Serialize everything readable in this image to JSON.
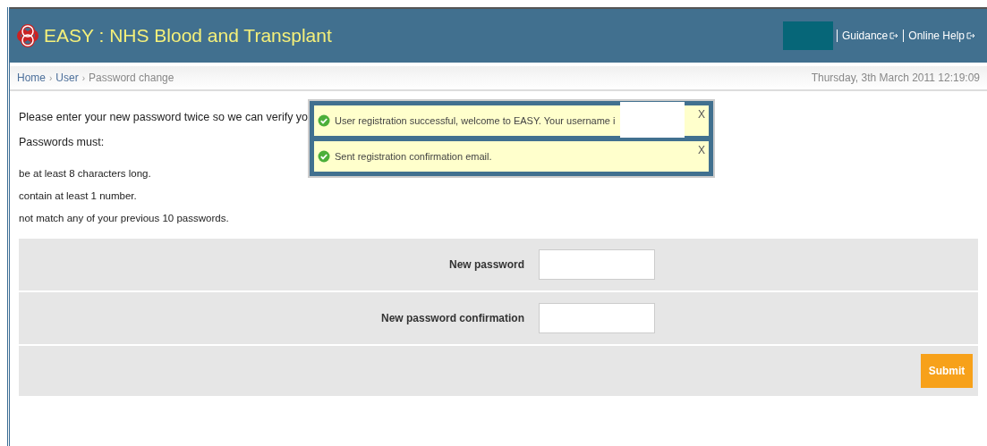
{
  "header": {
    "title": "EASY : NHS Blood and Transplant",
    "links": [
      {
        "label": "Guidance"
      },
      {
        "label": "Online Help"
      }
    ]
  },
  "breadcrumb": {
    "items": [
      {
        "label": "Home",
        "kind": "link"
      },
      {
        "label": "User",
        "kind": "link",
        "separator": "›"
      },
      {
        "label": "Password change",
        "kind": "current",
        "separator": "›"
      }
    ],
    "datetime": "Thursday, 3th March 2011 12:19:09"
  },
  "intro": "Please enter your new password twice so we can verify yo",
  "rules_heading": "Passwords must:",
  "rules": [
    "be at least 8 characters long.",
    "contain at least 1 number.",
    "not match any of your previous 10 passwords."
  ],
  "form": {
    "fields": [
      {
        "label": "New password"
      },
      {
        "label": "New password confirmation"
      }
    ],
    "submit": "Submit"
  },
  "notifications": [
    {
      "message": "User registration successful, welcome to EASY. Your username i",
      "close": "X",
      "redacted": true
    },
    {
      "message": "Sent registration confirmation email.",
      "close": "X",
      "redacted": false
    }
  ]
}
